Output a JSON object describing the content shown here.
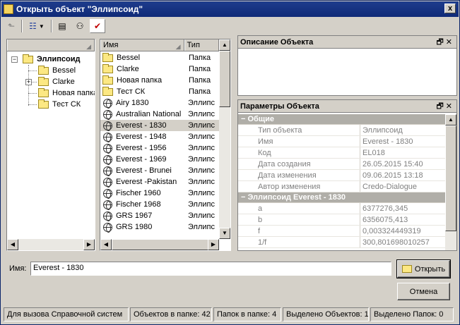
{
  "window": {
    "title": "Открыть объект \"Эллипсоид\"",
    "close": "x"
  },
  "tree": {
    "root": "Эллипсоид",
    "children": [
      "Bessel",
      "Clarke",
      "Новая папка",
      "Тест СК"
    ]
  },
  "list": {
    "columns": [
      "Имя",
      "Тип"
    ],
    "rows": [
      {
        "name": "Bessel",
        "type": "Папка",
        "icon": "folder-icon"
      },
      {
        "name": "Clarke",
        "type": "Папка",
        "icon": "folder-icon"
      },
      {
        "name": "Новая папка",
        "type": "Папка",
        "icon": "folder-icon"
      },
      {
        "name": "Тест СК",
        "type": "Папка",
        "icon": "folder-icon"
      },
      {
        "name": "Airy 1830",
        "type": "Эллипс",
        "icon": "globe-icon"
      },
      {
        "name": "Australian National",
        "type": "Эллипс",
        "icon": "globe-icon"
      },
      {
        "name": "Everest - 1830",
        "type": "Эллипс",
        "icon": "globe-icon"
      },
      {
        "name": "Everest - 1948",
        "type": "Эллипс",
        "icon": "globe-icon"
      },
      {
        "name": "Everest - 1956",
        "type": "Эллипс",
        "icon": "globe-icon"
      },
      {
        "name": "Everest - 1969",
        "type": "Эллипс",
        "icon": "globe-icon"
      },
      {
        "name": "Everest - Brunei",
        "type": "Эллипс",
        "icon": "globe-icon"
      },
      {
        "name": "Everest -Pakistan",
        "type": "Эллипс",
        "icon": "globe-icon"
      },
      {
        "name": "Fischer 1960",
        "type": "Эллипс",
        "icon": "globe-icon"
      },
      {
        "name": "Fischer 1968",
        "type": "Эллипс",
        "icon": "globe-icon"
      },
      {
        "name": "GRS 1967",
        "type": "Эллипс",
        "icon": "globe-icon"
      },
      {
        "name": "GRS 1980",
        "type": "Эллипс",
        "icon": "globe-icon"
      }
    ],
    "selected_index": 6
  },
  "description_panel": {
    "title": "Описание Объекта"
  },
  "params_panel": {
    "title": "Параметры Объекта",
    "groups": [
      {
        "title": "Общие",
        "rows": [
          {
            "k": "Тип объекта",
            "v": "Эллипсоид"
          },
          {
            "k": "Имя",
            "v": "Everest - 1830"
          },
          {
            "k": "Код",
            "v": "EL018"
          },
          {
            "k": "Дата создания",
            "v": "26.05.2015 15:40"
          },
          {
            "k": "Дата изменения",
            "v": "09.06.2015 13:18"
          },
          {
            "k": "Автор изменения",
            "v": "Credo-Dialogue"
          }
        ]
      },
      {
        "title": "Эллипсоид Everest - 1830",
        "rows": [
          {
            "k": "a",
            "v": "6377276,345"
          },
          {
            "k": "b",
            "v": "6356075,413"
          },
          {
            "k": "f",
            "v": "0,003324449319"
          },
          {
            "k": "1/f",
            "v": "300,801698010257"
          }
        ]
      }
    ]
  },
  "bottom": {
    "name_label": "Имя:",
    "name_value": "Everest - 1830",
    "open_button": "Открыть",
    "cancel_button": "Отмена"
  },
  "status": [
    "Для вызова Справочной систем",
    "Объектов в папке: 42",
    "Папок в папке: 4",
    "Выделено Объектов: 1",
    "Выделено Папок: 0"
  ]
}
